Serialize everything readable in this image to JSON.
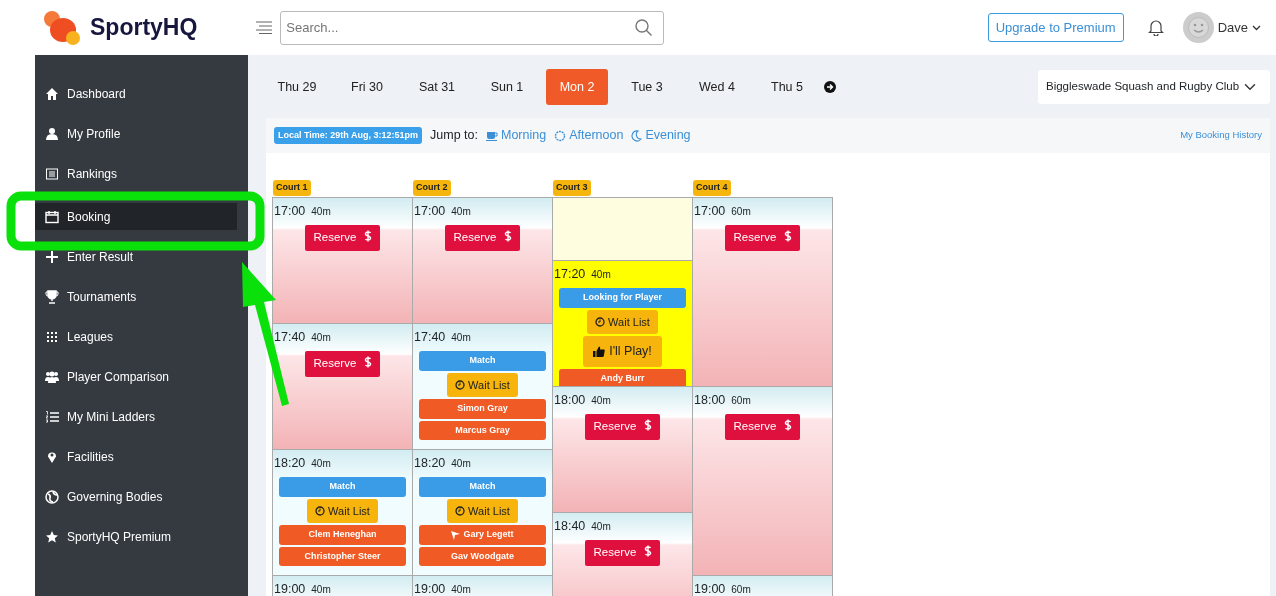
{
  "brand": "SportyHQ",
  "search": {
    "placeholder": "Search..."
  },
  "upgrade_button": "Upgrade to Premium",
  "user": {
    "name": "Dave"
  },
  "sidebar": {
    "items": [
      {
        "label": "Dashboard",
        "selected": false
      },
      {
        "label": "My Profile",
        "selected": false
      },
      {
        "label": "Rankings",
        "selected": false
      },
      {
        "label": "Booking",
        "selected": true
      },
      {
        "label": "Enter Result",
        "selected": false
      },
      {
        "label": "Tournaments",
        "selected": false
      },
      {
        "label": "Leagues",
        "selected": false
      },
      {
        "label": "Player Comparison",
        "selected": false
      },
      {
        "label": "My Mini Ladders",
        "selected": false
      },
      {
        "label": "Facilities",
        "selected": false
      },
      {
        "label": "Governing Bodies",
        "selected": false
      },
      {
        "label": "SportyHQ Premium",
        "selected": false
      }
    ]
  },
  "date_tabs": [
    {
      "label": "Thu 29",
      "selected": false
    },
    {
      "label": "Fri 30",
      "selected": false
    },
    {
      "label": "Sat 31",
      "selected": false
    },
    {
      "label": "Sun 1",
      "selected": false
    },
    {
      "label": "Mon 2",
      "selected": true
    },
    {
      "label": "Tue 3",
      "selected": false
    },
    {
      "label": "Wed 4",
      "selected": false
    },
    {
      "label": "Thu 5",
      "selected": false
    }
  ],
  "club_select": {
    "value": "Biggleswade Squash and Rugby Club"
  },
  "local_time": "Local Time: 29th Aug, 3:12:51pm",
  "jump_to": {
    "label": "Jump to:",
    "links": [
      "Morning",
      "Afternoon",
      "Evening"
    ]
  },
  "booking_history_link": "My Booking History",
  "courts": [
    {
      "name": "Court 1",
      "slots": [
        {
          "kind": "available",
          "time": "17:00",
          "duration": "40m",
          "button": "Reserve"
        },
        {
          "kind": "available",
          "time": "17:40",
          "duration": "40m",
          "button": "Reserve"
        },
        {
          "kind": "match",
          "time": "18:20",
          "duration": "40m",
          "label": "Match",
          "wait_list": "Wait List",
          "players": [
            {
              "name": "Clem Heneghan",
              "marked": false
            },
            {
              "name": "Christopher Steer",
              "marked": false
            }
          ]
        },
        {
          "kind": "available",
          "time": "19:00",
          "duration": "40m"
        }
      ]
    },
    {
      "name": "Court 2",
      "slots": [
        {
          "kind": "available",
          "time": "17:00",
          "duration": "40m",
          "button": "Reserve"
        },
        {
          "kind": "match",
          "time": "17:40",
          "duration": "40m",
          "label": "Match",
          "wait_list": "Wait List",
          "players": [
            {
              "name": "Simon Gray",
              "marked": false
            },
            {
              "name": "Marcus Gray",
              "marked": false
            }
          ]
        },
        {
          "kind": "match",
          "time": "18:20",
          "duration": "40m",
          "label": "Match",
          "wait_list": "Wait List",
          "players": [
            {
              "name": "Gary Legett",
              "marked": true
            },
            {
              "name": "Gav Woodgate",
              "marked": false
            }
          ]
        },
        {
          "kind": "available",
          "time": "19:00",
          "duration": "40m"
        }
      ]
    },
    {
      "name": "Court 3",
      "slots": [
        {
          "kind": "gap"
        },
        {
          "kind": "looking",
          "time": "17:20",
          "duration": "40m",
          "label": "Looking for Player",
          "wait_list": "Wait List",
          "play_button": "I'll Play!",
          "players": [
            {
              "name": "Andy Burr",
              "marked": false
            }
          ]
        },
        {
          "kind": "available",
          "time": "18:00",
          "duration": "40m",
          "button": "Reserve"
        },
        {
          "kind": "available",
          "time": "18:40",
          "duration": "40m",
          "button": "Reserve"
        }
      ]
    },
    {
      "name": "Court 4",
      "slots": [
        {
          "kind": "available",
          "time": "17:00",
          "duration": "60m",
          "button": "Reserve"
        },
        {
          "kind": "available",
          "time": "18:00",
          "duration": "60m",
          "button": "Reserve"
        },
        {
          "kind": "available",
          "time": "19:00",
          "duration": "60m"
        }
      ]
    }
  ]
}
